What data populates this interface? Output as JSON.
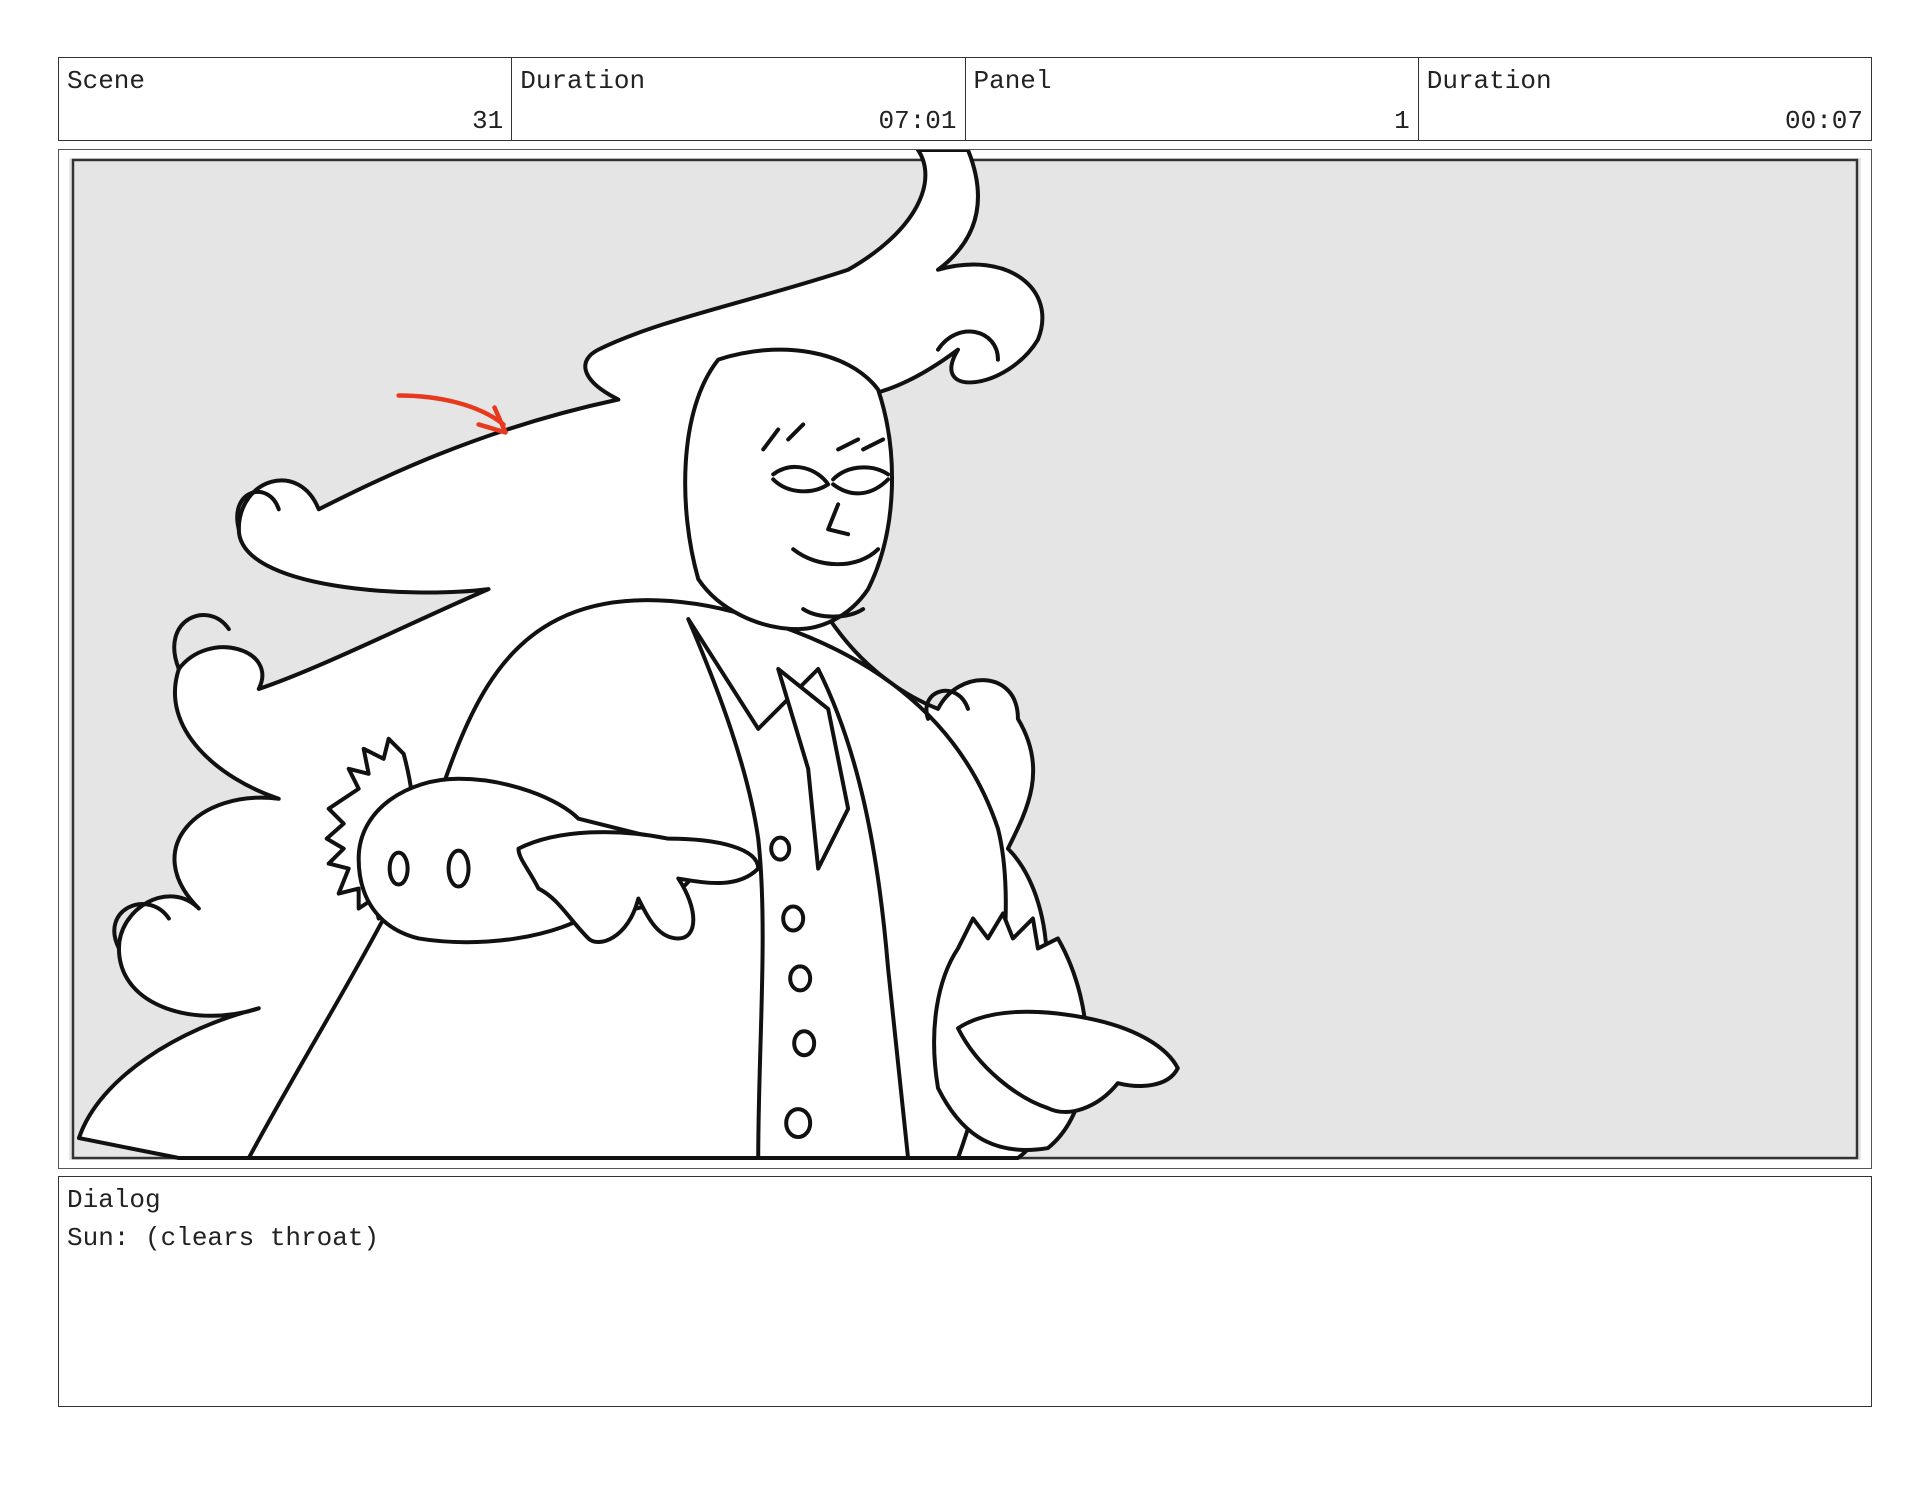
{
  "header": {
    "scene_label": "Scene",
    "scene_value": "31",
    "scene_duration_label": "Duration",
    "scene_duration_value": "07:01",
    "panel_label": "Panel",
    "panel_value": "1",
    "panel_duration_label": "Duration",
    "panel_duration_value": "00:07"
  },
  "panel": {
    "background_color": "#e5e5e5",
    "line_color": "#111111",
    "arrow_color": "#e8391e"
  },
  "dialog": {
    "label": "Dialog",
    "text": "Sun: (clears throat)"
  }
}
